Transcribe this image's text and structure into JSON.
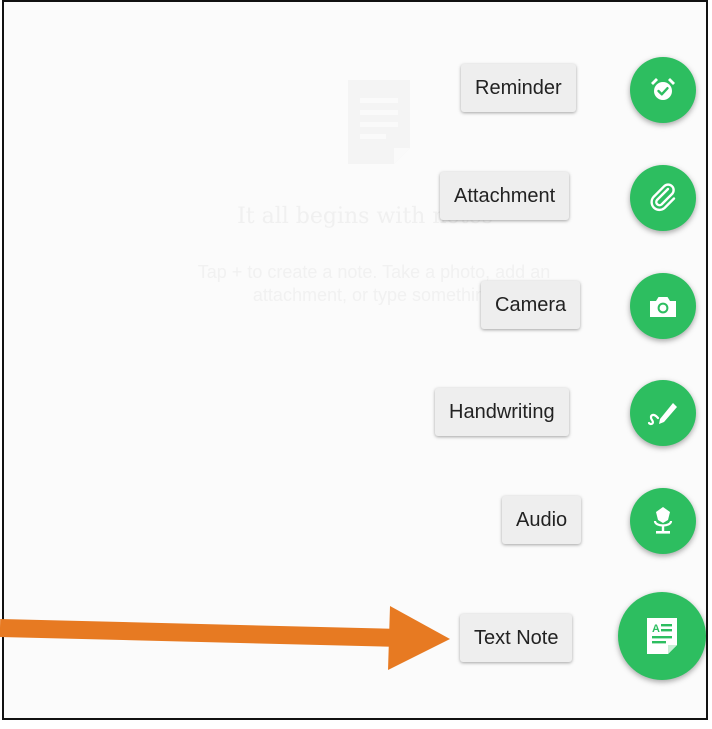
{
  "empty_state": {
    "title": "It all begins with notes",
    "body": "Tap + to create a note. Take a photo, add an attachment, or type something",
    "icon": "note-icon"
  },
  "actions": [
    {
      "label": "Reminder",
      "icon": "alarm-clock-icon"
    },
    {
      "label": "Attachment",
      "icon": "paperclip-icon"
    },
    {
      "label": "Camera",
      "icon": "camera-icon"
    },
    {
      "label": "Handwriting",
      "icon": "pen-icon"
    },
    {
      "label": "Audio",
      "icon": "microphone-icon"
    },
    {
      "label": "Text Note",
      "icon": "text-note-icon"
    }
  ],
  "colors": {
    "fab": "#2dbe60",
    "arrow": "#e77a22",
    "label_bg": "#eeeeee"
  }
}
